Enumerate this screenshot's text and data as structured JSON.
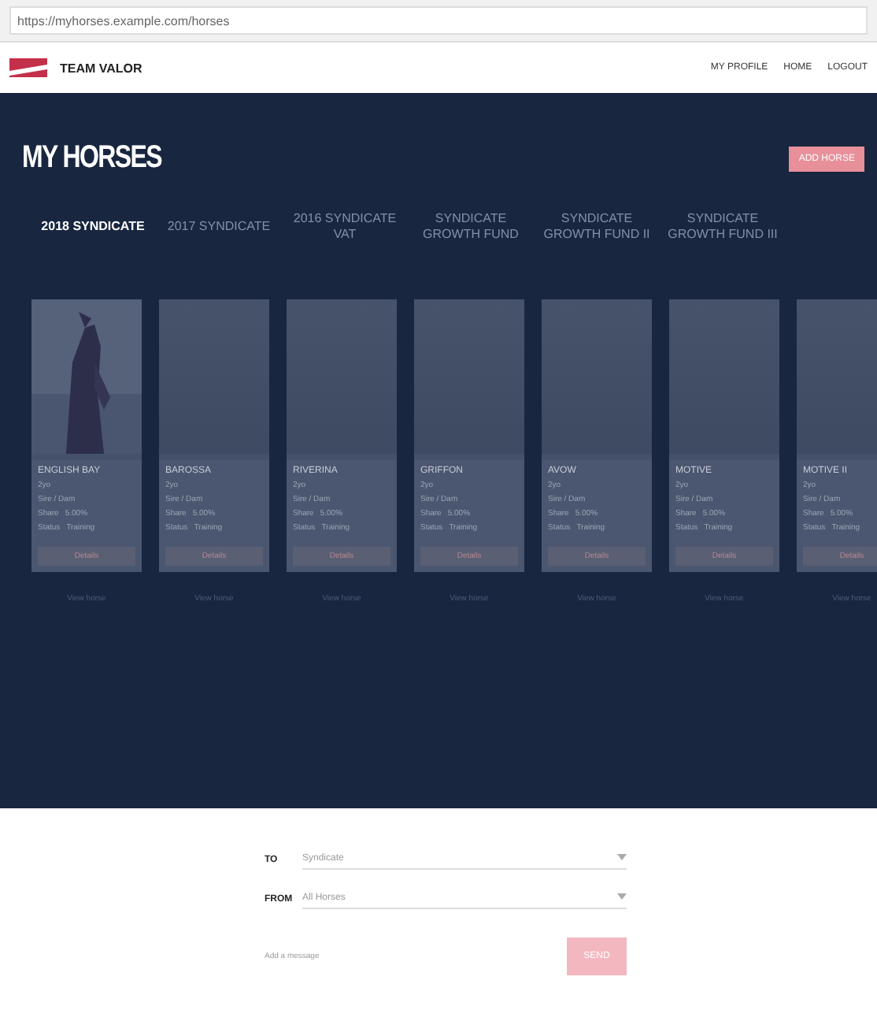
{
  "browser": {
    "url": "https://myhorses.example.com/horses"
  },
  "header": {
    "brand": "TEAM VALOR",
    "nav": [
      {
        "label": "MY PROFILE"
      },
      {
        "label": "HOME"
      },
      {
        "label": "LOGOUT"
      }
    ]
  },
  "page": {
    "title": "MY HORSES",
    "action": "ADD HORSE"
  },
  "tabs": [
    {
      "label": "2018 SYNDICATE",
      "selected": true
    },
    {
      "label": "2017 SYNDICATE",
      "selected": false
    },
    {
      "label": "2016 SYNDICATE VAT",
      "selected": false
    },
    {
      "label": "SYNDICATE GROWTH FUND",
      "selected": false
    },
    {
      "label": "SYNDICATE GROWTH FUND II",
      "selected": false
    },
    {
      "label": "SYNDICATE GROWTH FUND III",
      "selected": false
    }
  ],
  "horses": [
    {
      "name": "ENGLISH BAY",
      "age": "2yo",
      "sire": "Sire / Dam",
      "share_label": "Share",
      "share": "5.00%",
      "status_label": "Status",
      "status": "Training",
      "button": "Details",
      "link": "View horse",
      "has_photo": true
    },
    {
      "name": "BAROSSA",
      "age": "2yo",
      "sire": "Sire / Dam",
      "share_label": "Share",
      "share": "5.00%",
      "status_label": "Status",
      "status": "Training",
      "button": "Details",
      "link": "View horse",
      "has_photo": false
    },
    {
      "name": "RIVERINA",
      "age": "2yo",
      "sire": "Sire / Dam",
      "share_label": "Share",
      "share": "5.00%",
      "status_label": "Status",
      "status": "Training",
      "button": "Details",
      "link": "View horse",
      "has_photo": false
    },
    {
      "name": "GRIFFON",
      "age": "2yo",
      "sire": "Sire / Dam",
      "share_label": "Share",
      "share": "5.00%",
      "status_label": "Status",
      "status": "Training",
      "button": "Details",
      "link": "View horse",
      "has_photo": false
    },
    {
      "name": "AVOW",
      "age": "2yo",
      "sire": "Sire / Dam",
      "share_label": "Share",
      "share": "5.00%",
      "status_label": "Status",
      "status": "Training",
      "button": "Details",
      "link": "View horse",
      "has_photo": false
    },
    {
      "name": "MOTIVE",
      "age": "2yo",
      "sire": "Sire / Dam",
      "share_label": "Share",
      "share": "5.00%",
      "status_label": "Status",
      "status": "Training",
      "button": "Details",
      "link": "View horse",
      "has_photo": false
    },
    {
      "name": "MOTIVE II",
      "age": "2yo",
      "sire": "Sire / Dam",
      "share_label": "Share",
      "share": "5.00%",
      "status_label": "Status",
      "status": "Training",
      "button": "Details",
      "link": "View horse",
      "has_photo": false
    }
  ],
  "form": {
    "fields": [
      {
        "label": "TO",
        "value": "Syndicate"
      },
      {
        "label": "FROM",
        "value": "All Horses"
      }
    ],
    "note": "Add a message",
    "submit": "SEND"
  }
}
